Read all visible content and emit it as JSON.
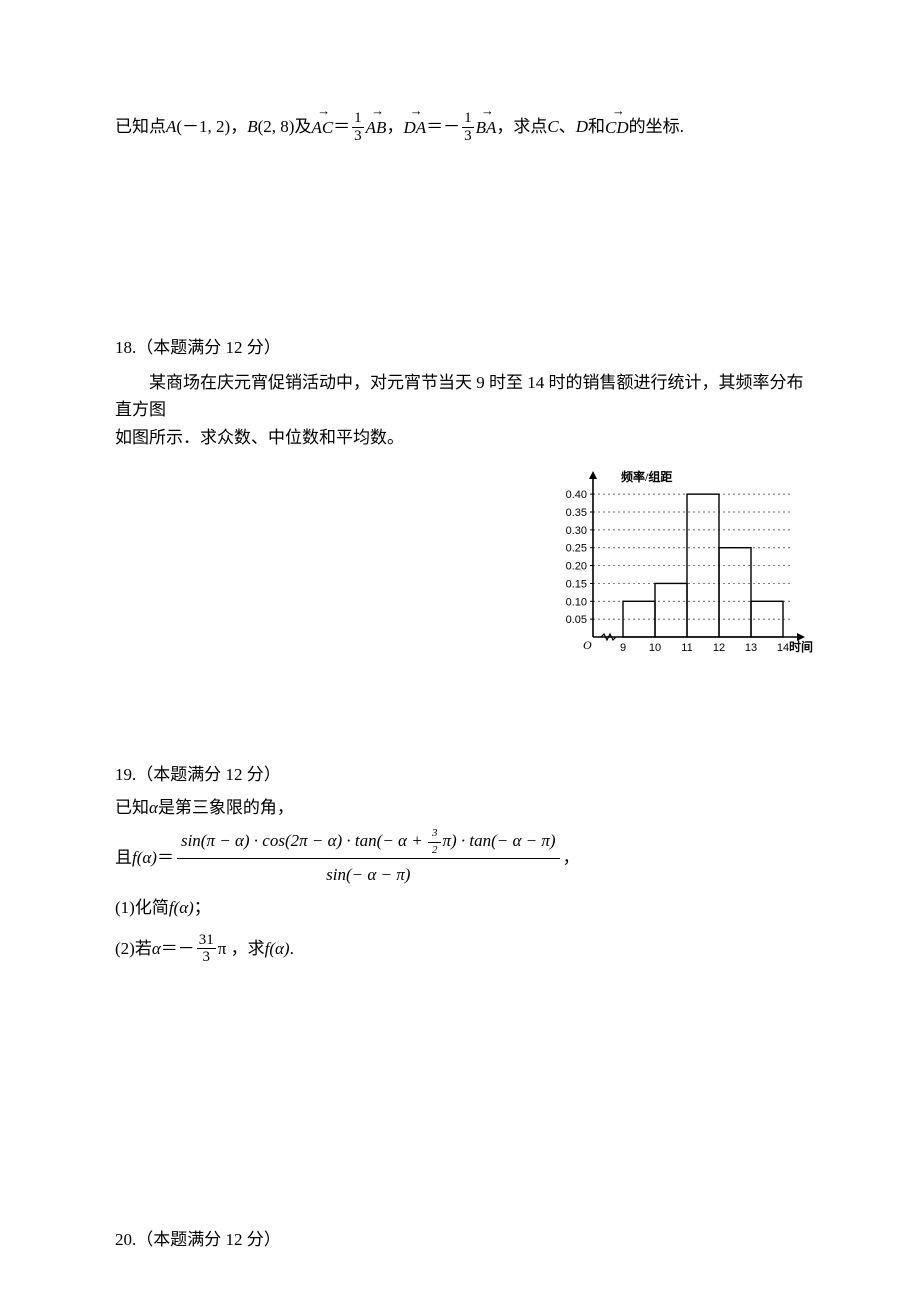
{
  "q17": {
    "prefix": "已知点 ",
    "ptA_name": "A",
    "ptA_coords": "(－1, 2)",
    "comma1": "，",
    "ptB_name": "B",
    "ptB_coords": "(2, 8) ",
    "and": "及",
    "vecAC": "AC",
    "eq1": "＝",
    "frac1_num": "1",
    "frac1_den": "3",
    "vecAB": "AB",
    "comma2": "，",
    "vecDA": "DA",
    "eq2": "＝－",
    "frac2_num": "1",
    "frac2_den": "3",
    "vecBA": "BA",
    "comma3": "，",
    "ask": "求点 ",
    "C": "C",
    "dun": "、",
    "D": "D",
    "and2": " 和",
    "vecCD": "CD",
    "suffix": "的坐标."
  },
  "q18": {
    "header": "18.（本题满分 12 分）",
    "line1": "某商场在庆元宵促销活动中，对元宵节当天 9 时至 14 时的销售额进行统计，其频率分布直方图",
    "line2": "如图所示．求众数、中位数和平均数。"
  },
  "q19": {
    "header": "19.（本题满分 12 分）",
    "line1a": "已知",
    "line1_alpha": "α",
    "line1b": "是第三象限的角，",
    "line2_prefix": "且 ",
    "fna": "f(α)",
    "eq": "＝",
    "numerator": "sin(π − α) · cos(2π − α) · tan(− α + ³⁄₂π) · tan(− α − π)",
    "denominator": "sin(− α − π)",
    "comma": "，",
    "part1": "(1)化简 ",
    "part1_fn": "f(α)",
    "part1_end": "；",
    "part2_a": "(2)若",
    "part2_alpha": "α",
    "part2_eq": "＝－",
    "part2_num": "31",
    "part2_den": "3",
    "part2_pi": "π ，",
    "part2_ask": "求 ",
    "part2_fn": "f(α)",
    "part2_end": "."
  },
  "q20": {
    "header": "20.（本题满分 12 分）"
  },
  "chart_data": {
    "type": "bar",
    "categories": [
      "9",
      "10",
      "11",
      "12",
      "13",
      "14"
    ],
    "bar_intervals": [
      "9-10",
      "10-11",
      "11-12",
      "12-13",
      "13-14"
    ],
    "values": [
      0.1,
      0.15,
      0.4,
      0.25,
      0.1
    ],
    "title": "频率/组距",
    "xlabel": "时间",
    "ylabel": "",
    "yticks": [
      0.05,
      0.1,
      0.15,
      0.2,
      0.25,
      0.3,
      0.35,
      0.4
    ],
    "ylim": [
      0,
      0.42
    ],
    "xlim": [
      "9",
      "14"
    ]
  }
}
